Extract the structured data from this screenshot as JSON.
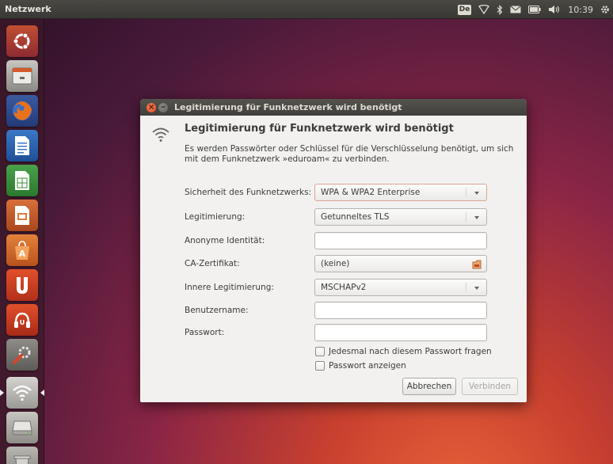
{
  "top_panel": {
    "app_title": "Netzwerk",
    "keyboard_layout": "De",
    "clock": "10:39"
  },
  "launcher": {
    "items": [
      {
        "name": "dash-home",
        "icon": "ubuntu-logo-icon"
      },
      {
        "name": "files",
        "icon": "file-cabinet-icon"
      },
      {
        "name": "firefox",
        "icon": "firefox-icon"
      },
      {
        "name": "libreoffice-writer",
        "icon": "writer-doc-icon"
      },
      {
        "name": "libreoffice-calc",
        "icon": "calc-sheet-icon"
      },
      {
        "name": "libreoffice-impress",
        "icon": "impress-slide-icon"
      },
      {
        "name": "software-center",
        "icon": "software-center-bag-icon"
      },
      {
        "name": "ubuntu-one",
        "icon": "ubuntu-one-icon"
      },
      {
        "name": "ubuntu-one-music",
        "icon": "music-headphones-icon"
      },
      {
        "name": "system-settings",
        "icon": "settings-wrench-icon"
      },
      {
        "name": "network",
        "icon": "wifi-icon",
        "active": true
      },
      {
        "name": "drive",
        "icon": "hard-drive-icon"
      },
      {
        "name": "trash",
        "icon": "trash-icon"
      }
    ]
  },
  "dialog": {
    "title": "Legitimierung für Funknetzwerk wird benötigt",
    "heading": "Legitimierung für Funknetzwerk wird benötigt",
    "description": "Es werden Passwörter oder Schlüssel für die Verschlüsselung benötigt, um sich mit dem Funknetzwerk »eduroam« zu verbinden.",
    "fields": {
      "security_label": "Sicherheit des Funknetzwerks:",
      "security_value": "WPA & WPA2 Enterprise",
      "auth_label": "Legitimierung:",
      "auth_value": "Getunneltes TLS",
      "anon_label": "Anonyme Identität:",
      "anon_value": "",
      "ca_label": "CA-Zertifikat:",
      "ca_value": "(keine)",
      "inner_label": "Innere Legitimierung:",
      "inner_value": "MSCHAPv2",
      "user_label": "Benutzername:",
      "user_value": "",
      "pass_label": "Passwort:",
      "pass_value": ""
    },
    "checkboxes": {
      "ask_every_time": "Jedesmal nach diesem Passwort fragen",
      "show_password": "Passwort anzeigen"
    },
    "buttons": {
      "cancel": "Abbrechen",
      "connect": "Verbinden"
    }
  },
  "colors": {
    "accent_orange": "#df4a1e",
    "panel_bg": "#3a3834",
    "dialog_bg": "#f2f1f0"
  }
}
